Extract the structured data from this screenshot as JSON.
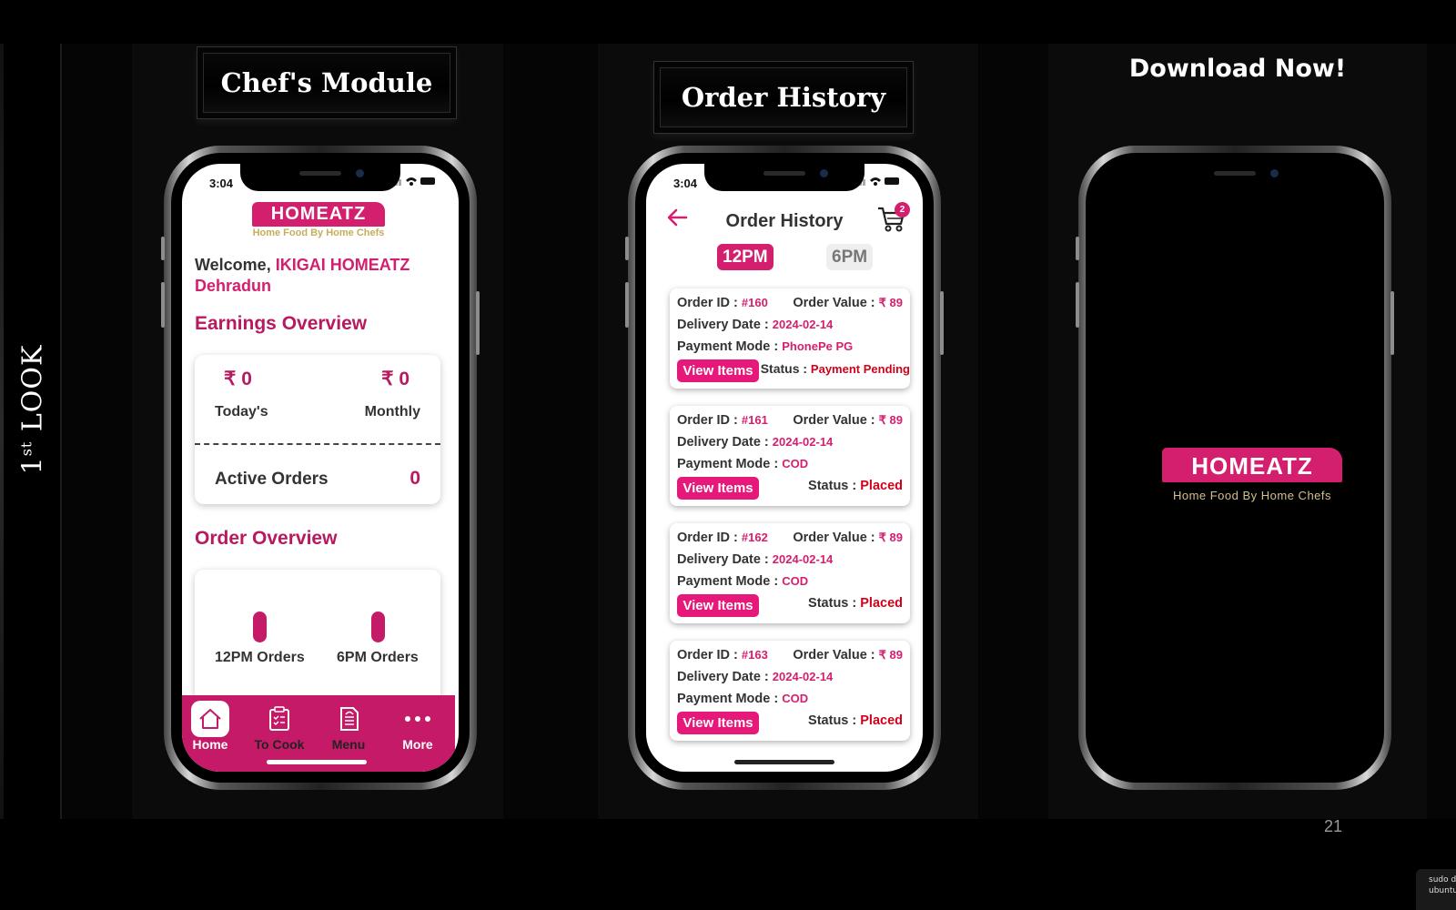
{
  "slide": {
    "vertical_title": "1",
    "vertical_title_sup": "st",
    "vertical_title_rest": " LOOK",
    "page_number": "21",
    "terminal_fragment": [
      "sudo d",
      "ubuntu-"
    ]
  },
  "banners": {
    "chef_module": "Chef's Module",
    "order_history": "Order History",
    "download": "Download Now!"
  },
  "colors": {
    "accent": "#d41f6f",
    "accent_dark": "#b8195f",
    "nav": "#c51a68",
    "tagline_gold": "#c6ad5a",
    "status_red": "#d0021b"
  },
  "chef_screen": {
    "status_time": "3:04",
    "logo": "HOMEATZ",
    "tagline": "Home Food By Home Chefs",
    "welcome_prefix": "Welcome, ",
    "welcome_name": "IKIGAI HOMEATZ",
    "city": "Dehradun",
    "earnings_title": "Earnings Overview",
    "today_amount": "₹ 0",
    "today_label": "Today's",
    "monthly_amount": "₹ 0",
    "monthly_label": "Monthly",
    "active_orders_label": "Active Orders",
    "active_orders_value": "0",
    "order_overview_title": "Order Overview",
    "bars": [
      {
        "label": "12PM Orders"
      },
      {
        "label": "6PM Orders"
      }
    ],
    "nav": [
      {
        "label": "Home",
        "icon": "home-icon",
        "active": true
      },
      {
        "label": "To Cook",
        "icon": "clipboard-check-icon",
        "active": false
      },
      {
        "label": "Menu",
        "icon": "menu-document-icon",
        "active": false
      },
      {
        "label": "More",
        "icon": "more-dots-icon",
        "active": false
      }
    ]
  },
  "history_screen": {
    "status_time": "3:04",
    "title": "Order History",
    "cart_count": "2",
    "tabs": [
      "12PM",
      "6PM"
    ],
    "labels": {
      "order_id": "Order ID : ",
      "order_value": "Order Value : ",
      "delivery_date": "Delivery Date : ",
      "payment_mode": "Payment Mode : ",
      "status": "Status : ",
      "view_items": "View Items"
    },
    "orders": [
      {
        "id": "#160",
        "value": "₹ 89",
        "date": "2024-02-14",
        "payment": "PhonePe PG",
        "status": "Payment Pending"
      },
      {
        "id": "#161",
        "value": "₹ 89",
        "date": "2024-02-14",
        "payment": "COD",
        "status": "Placed"
      },
      {
        "id": "#162",
        "value": "₹ 89",
        "date": "2024-02-14",
        "payment": "COD",
        "status": "Placed"
      },
      {
        "id": "#163",
        "value": "₹ 89",
        "date": "2024-02-14",
        "payment": "COD",
        "status": "Placed"
      }
    ]
  },
  "splash_screen": {
    "logo": "HOMEATZ",
    "tagline": "Home Food By Home Chefs"
  }
}
